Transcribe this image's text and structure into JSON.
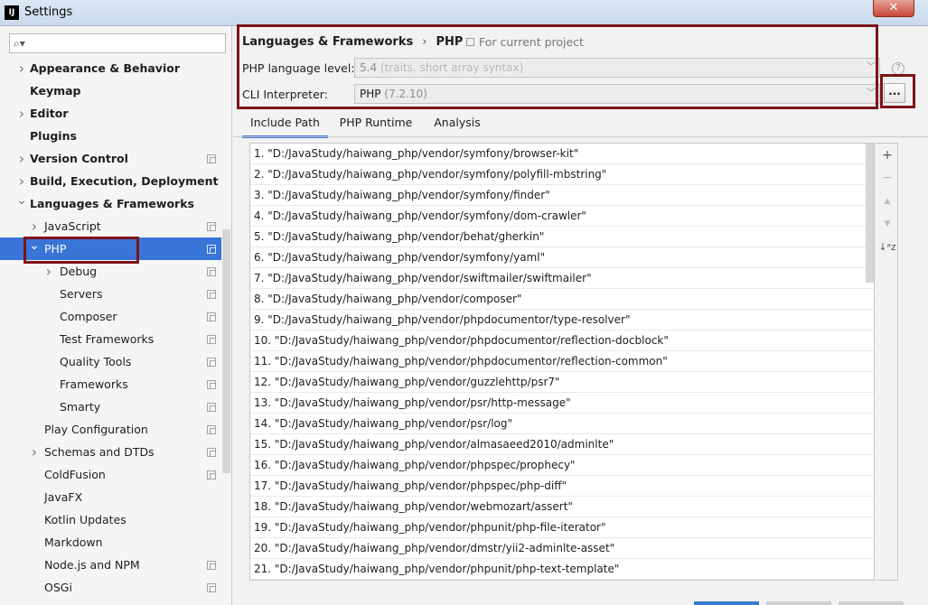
{
  "window": {
    "title": "Settings",
    "app_icon": "IJ"
  },
  "sidebar": {
    "search": {
      "value": "",
      "placeholder": ""
    },
    "items": [
      {
        "label": "Appearance & Behavior",
        "level": 0,
        "bold": true,
        "arrow": "collapsed",
        "project": false
      },
      {
        "label": "Keymap",
        "level": 0,
        "bold": true,
        "arrow": "none",
        "project": false
      },
      {
        "label": "Editor",
        "level": 0,
        "bold": true,
        "arrow": "collapsed",
        "project": false
      },
      {
        "label": "Plugins",
        "level": 0,
        "bold": true,
        "arrow": "none",
        "project": false
      },
      {
        "label": "Version Control",
        "level": 0,
        "bold": true,
        "arrow": "collapsed",
        "project": true
      },
      {
        "label": "Build, Execution, Deployment",
        "level": 0,
        "bold": true,
        "arrow": "collapsed",
        "project": false
      },
      {
        "label": "Languages & Frameworks",
        "level": 0,
        "bold": true,
        "arrow": "expanded",
        "project": false
      },
      {
        "label": "JavaScript",
        "level": 1,
        "bold": false,
        "arrow": "collapsed",
        "project": true
      },
      {
        "label": "PHP",
        "level": 1,
        "bold": false,
        "arrow": "expanded",
        "project": true,
        "selected": true
      },
      {
        "label": "Debug",
        "level": 2,
        "bold": false,
        "arrow": "collapsed",
        "project": true
      },
      {
        "label": "Servers",
        "level": 2,
        "bold": false,
        "arrow": "none",
        "project": true
      },
      {
        "label": "Composer",
        "level": 2,
        "bold": false,
        "arrow": "none",
        "project": true
      },
      {
        "label": "Test Frameworks",
        "level": 2,
        "bold": false,
        "arrow": "none",
        "project": true
      },
      {
        "label": "Quality Tools",
        "level": 2,
        "bold": false,
        "arrow": "none",
        "project": true
      },
      {
        "label": "Frameworks",
        "level": 2,
        "bold": false,
        "arrow": "none",
        "project": true
      },
      {
        "label": "Smarty",
        "level": 2,
        "bold": false,
        "arrow": "none",
        "project": true
      },
      {
        "label": "Play Configuration",
        "level": 1,
        "bold": false,
        "arrow": "none",
        "project": true
      },
      {
        "label": "Schemas and DTDs",
        "level": 1,
        "bold": false,
        "arrow": "collapsed",
        "project": true
      },
      {
        "label": "ColdFusion",
        "level": 1,
        "bold": false,
        "arrow": "none",
        "project": true
      },
      {
        "label": "JavaFX",
        "level": 1,
        "bold": false,
        "arrow": "none",
        "project": false
      },
      {
        "label": "Kotlin Updates",
        "level": 1,
        "bold": false,
        "arrow": "none",
        "project": false
      },
      {
        "label": "Markdown",
        "level": 1,
        "bold": false,
        "arrow": "none",
        "project": false
      },
      {
        "label": "Node.js and NPM",
        "level": 1,
        "bold": false,
        "arrow": "none",
        "project": true
      },
      {
        "label": "OSGi",
        "level": 1,
        "bold": false,
        "arrow": "none",
        "project": true
      }
    ]
  },
  "breadcrumb": {
    "parent": "Languages & Frameworks",
    "separator": "›",
    "current": "PHP"
  },
  "project_note": "For current project",
  "fields": {
    "language_level": {
      "label": "PHP language level:",
      "value": "5.4",
      "hint": "(traits, short array syntax)"
    },
    "cli_interpreter": {
      "label": "CLI Interpreter:",
      "value": "PHP",
      "hint": "(7.2.10)"
    },
    "help": "?",
    "more_button": "..."
  },
  "tabs": [
    {
      "label": "Include Path",
      "active": true
    },
    {
      "label": "PHP Runtime",
      "active": false
    },
    {
      "label": "Analysis",
      "active": false
    }
  ],
  "include_paths": [
    "1. \"D:/JavaStudy/haiwang_php/vendor/symfony/browser-kit\"",
    "2. \"D:/JavaStudy/haiwang_php/vendor/symfony/polyfill-mbstring\"",
    "3. \"D:/JavaStudy/haiwang_php/vendor/symfony/finder\"",
    "4. \"D:/JavaStudy/haiwang_php/vendor/symfony/dom-crawler\"",
    "5. \"D:/JavaStudy/haiwang_php/vendor/behat/gherkin\"",
    "6. \"D:/JavaStudy/haiwang_php/vendor/symfony/yaml\"",
    "7. \"D:/JavaStudy/haiwang_php/vendor/swiftmailer/swiftmailer\"",
    "8. \"D:/JavaStudy/haiwang_php/vendor/composer\"",
    "9. \"D:/JavaStudy/haiwang_php/vendor/phpdocumentor/type-resolver\"",
    "10. \"D:/JavaStudy/haiwang_php/vendor/phpdocumentor/reflection-docblock\"",
    "11. \"D:/JavaStudy/haiwang_php/vendor/phpdocumentor/reflection-common\"",
    "12. \"D:/JavaStudy/haiwang_php/vendor/guzzlehttp/psr7\"",
    "13. \"D:/JavaStudy/haiwang_php/vendor/psr/http-message\"",
    "14. \"D:/JavaStudy/haiwang_php/vendor/psr/log\"",
    "15. \"D:/JavaStudy/haiwang_php/vendor/almasaeed2010/adminlte\"",
    "16. \"D:/JavaStudy/haiwang_php/vendor/phpspec/prophecy\"",
    "17. \"D:/JavaStudy/haiwang_php/vendor/phpspec/php-diff\"",
    "18. \"D:/JavaStudy/haiwang_php/vendor/webmozart/assert\"",
    "19. \"D:/JavaStudy/haiwang_php/vendor/phpunit/php-file-iterator\"",
    "20. \"D:/JavaStudy/haiwang_php/vendor/dmstr/yii2-adminlte-asset\"",
    "21. \"D:/JavaStudy/haiwang_php/vendor/phpunit/php-text-template\""
  ],
  "toolbar": {
    "add": "+",
    "remove": "−",
    "move_up": "▲",
    "move_down": "▼",
    "sort": "↓ᵃz"
  }
}
